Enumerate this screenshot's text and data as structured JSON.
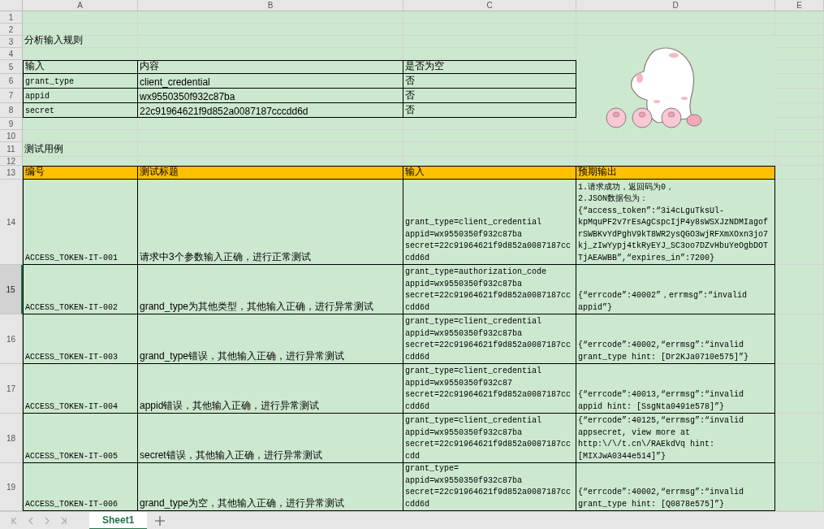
{
  "sheet": {
    "column_headers": [
      "A",
      "B",
      "C",
      "D",
      "E"
    ],
    "row_headers": [
      {
        "label": "1",
        "selected": false
      },
      {
        "label": "2",
        "selected": false
      },
      {
        "label": "3",
        "selected": false
      },
      {
        "label": "4",
        "selected": false
      },
      {
        "label": "5",
        "selected": false
      },
      {
        "label": "6",
        "selected": false
      },
      {
        "label": "7",
        "selected": false
      },
      {
        "label": "8",
        "selected": false
      },
      {
        "label": "9",
        "selected": false
      },
      {
        "label": "10",
        "selected": false
      },
      {
        "label": "11",
        "selected": false
      },
      {
        "label": "12",
        "selected": false
      },
      {
        "label": "13",
        "selected": false
      },
      {
        "label": "14",
        "selected": false
      },
      {
        "label": "15",
        "selected": true
      },
      {
        "label": "16",
        "selected": false
      },
      {
        "label": "17",
        "selected": false
      },
      {
        "label": "18",
        "selected": false
      },
      {
        "label": "19",
        "selected": false
      }
    ],
    "rules_title": "分析输入规则",
    "rules_table": {
      "columns": [
        "输入",
        "内容",
        "是否为空"
      ],
      "rows": [
        {
          "name": "grant_type",
          "content": "client_credential",
          "empty": "否"
        },
        {
          "name": "appid",
          "content": "wx9550350f932c87ba",
          "empty": "否"
        },
        {
          "name": "secret",
          "content": "22c91964621f9d852a0087187cccdd6d",
          "empty": "否"
        }
      ]
    },
    "cases_title": "测试用例",
    "test_table": {
      "columns": [
        "编号",
        "测试标题",
        "输入",
        "预期输出"
      ],
      "rows": [
        {
          "id": "ACCESS_TOKEN-IT-001",
          "title": "请求中3个参数输入正确，进行正常测试",
          "input": "grant_type=client_credential\nappid=wx9550350f932c87ba\nsecret=22c91964621f9d852a0087187cc\ncdd6d",
          "expected": "1.请求成功，返回码为0，\n2.JSON数据包为：\n{“access_token”:“3i4cLguTksUl-\nkpMquPF2v7rEsAgCspcIjP4y8sWSXJzNDMIagof\nrSWBKvYdPghV9kT8WR2ysQGO3wjRFXmXOxn3jo7\nkj_zIwYypj4tkRyEYJ_SC3oo7DZvHbuYeOgbDOT\nTjAEAWBB”,“expires_in”:7200}"
        },
        {
          "id": "ACCESS_TOKEN-IT-002",
          "title": "grand_type为其他类型，其他输入正确，进行异常测试",
          "input": "grant_type=authorization_code\nappid=wx9550350f932c87ba\nsecret=22c91964621f9d852a0087187cc\ncdd6d",
          "expected": "{“errcode”:40002”，errmsg”:“invalid\nappid”}"
        },
        {
          "id": "ACCESS_TOKEN-IT-003",
          "title": "grand_type错误，其他输入正确，进行异常测试",
          "input": "grant_type=client_credential\nappid=wx9550350f932c87ba\nsecret=22c91964621f9d852a0087187cc\ncdd6d",
          "expected": "{“errcode”:40002,“errmsg”:“invalid\ngrant_type hint: [Dr2KJa0710e575]”}"
        },
        {
          "id": "ACCESS_TOKEN-IT-004",
          "title": "appid错误，其他输入正确，进行异常测试",
          "input": "grant_type=client_credential\nappid=wx9550350f932c87\nsecret=22c91964621f9d852a0087187cc\ncdd6d",
          "expected": "{“errcode”:40013,“errmsg”:“invalid\nappid hint: [SsgNta0491e578]”}"
        },
        {
          "id": "ACCESS_TOKEN-IT-005",
          "title": "secret错误，其他输入正确，进行异常测试",
          "input": "grant_type=client_credential\nappid=wx9550350f932c87ba\nsecret=22c91964621f9d852a0087187cc\ncdd",
          "expected": "{“errcode”:40125,“errmsg”:“invalid\nappsecret, view more at\nhttp:\\/\\/t.cn\\/RAEkdVq hint:\n[MIXJwA0344e514]”}"
        },
        {
          "id": "ACCESS_TOKEN-IT-006",
          "title": "grand_type为空，其他输入正确，进行异常测试",
          "input": "grant_type=\nappid=wx9550350f932c87ba\nsecret=22c91964621f9d852a0087187cc\ncdd6d",
          "expected": "{“errcode”:40002,“errmsg”:“invalid\ngrant_type hint: [Q0878e575]”}"
        }
      ]
    }
  },
  "sheet_tabs": [
    {
      "label": "Sheet1",
      "selected": true
    }
  ]
}
